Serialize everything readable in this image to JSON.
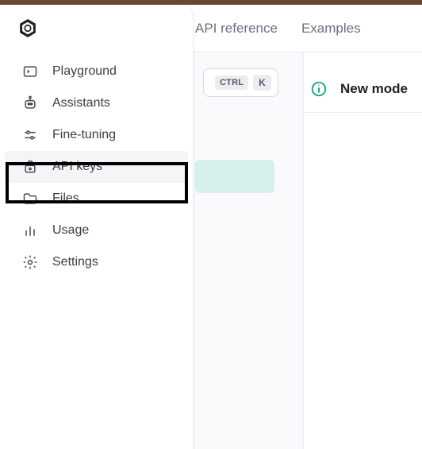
{
  "header": {
    "nav": [
      {
        "label": "API reference"
      },
      {
        "label": "Examples"
      }
    ]
  },
  "kbd": {
    "ctrl": "CTRL",
    "k": "K"
  },
  "banner": {
    "title": "New mode"
  },
  "sidebar": {
    "items": [
      {
        "label": "Playground",
        "icon": "terminal-icon"
      },
      {
        "label": "Assistants",
        "icon": "robot-icon"
      },
      {
        "label": "Fine-tuning",
        "icon": "sliders-icon"
      },
      {
        "label": "API keys",
        "icon": "lock-icon",
        "active": true
      },
      {
        "label": "Files",
        "icon": "folder-icon"
      },
      {
        "label": "Usage",
        "icon": "chart-icon"
      },
      {
        "label": "Settings",
        "icon": "gear-icon"
      }
    ]
  }
}
